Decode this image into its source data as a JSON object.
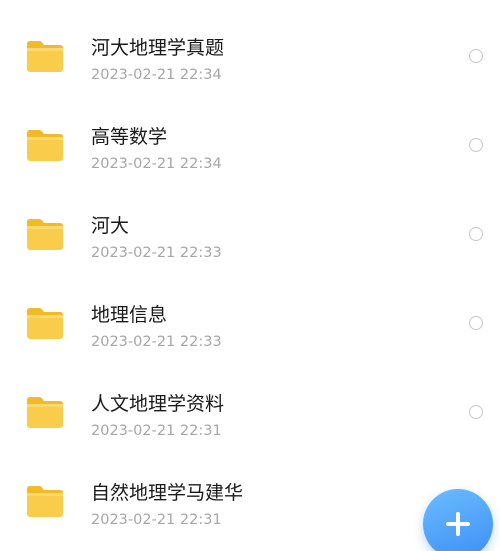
{
  "files": [
    {
      "name": "河大地理学真题",
      "date": "2023-02-21 22:34",
      "icon": "folder-icon"
    },
    {
      "name": "高等数学",
      "date": "2023-02-21 22:34",
      "icon": "folder-icon"
    },
    {
      "name": "河大",
      "date": "2023-02-21 22:33",
      "icon": "folder-icon"
    },
    {
      "name": "地理信息",
      "date": "2023-02-21 22:33",
      "icon": "folder-icon"
    },
    {
      "name": "人文地理学资料",
      "date": "2023-02-21 22:31",
      "icon": "folder-icon"
    },
    {
      "name": "自然地理学马建华",
      "date": "2023-02-21 22:31",
      "icon": "folder-icon"
    }
  ],
  "fab": {
    "icon": "plus-icon"
  },
  "colors": {
    "folder": "#f9cc4c",
    "fab": "#4a9cf7",
    "date_text": "#a6a6a6"
  }
}
